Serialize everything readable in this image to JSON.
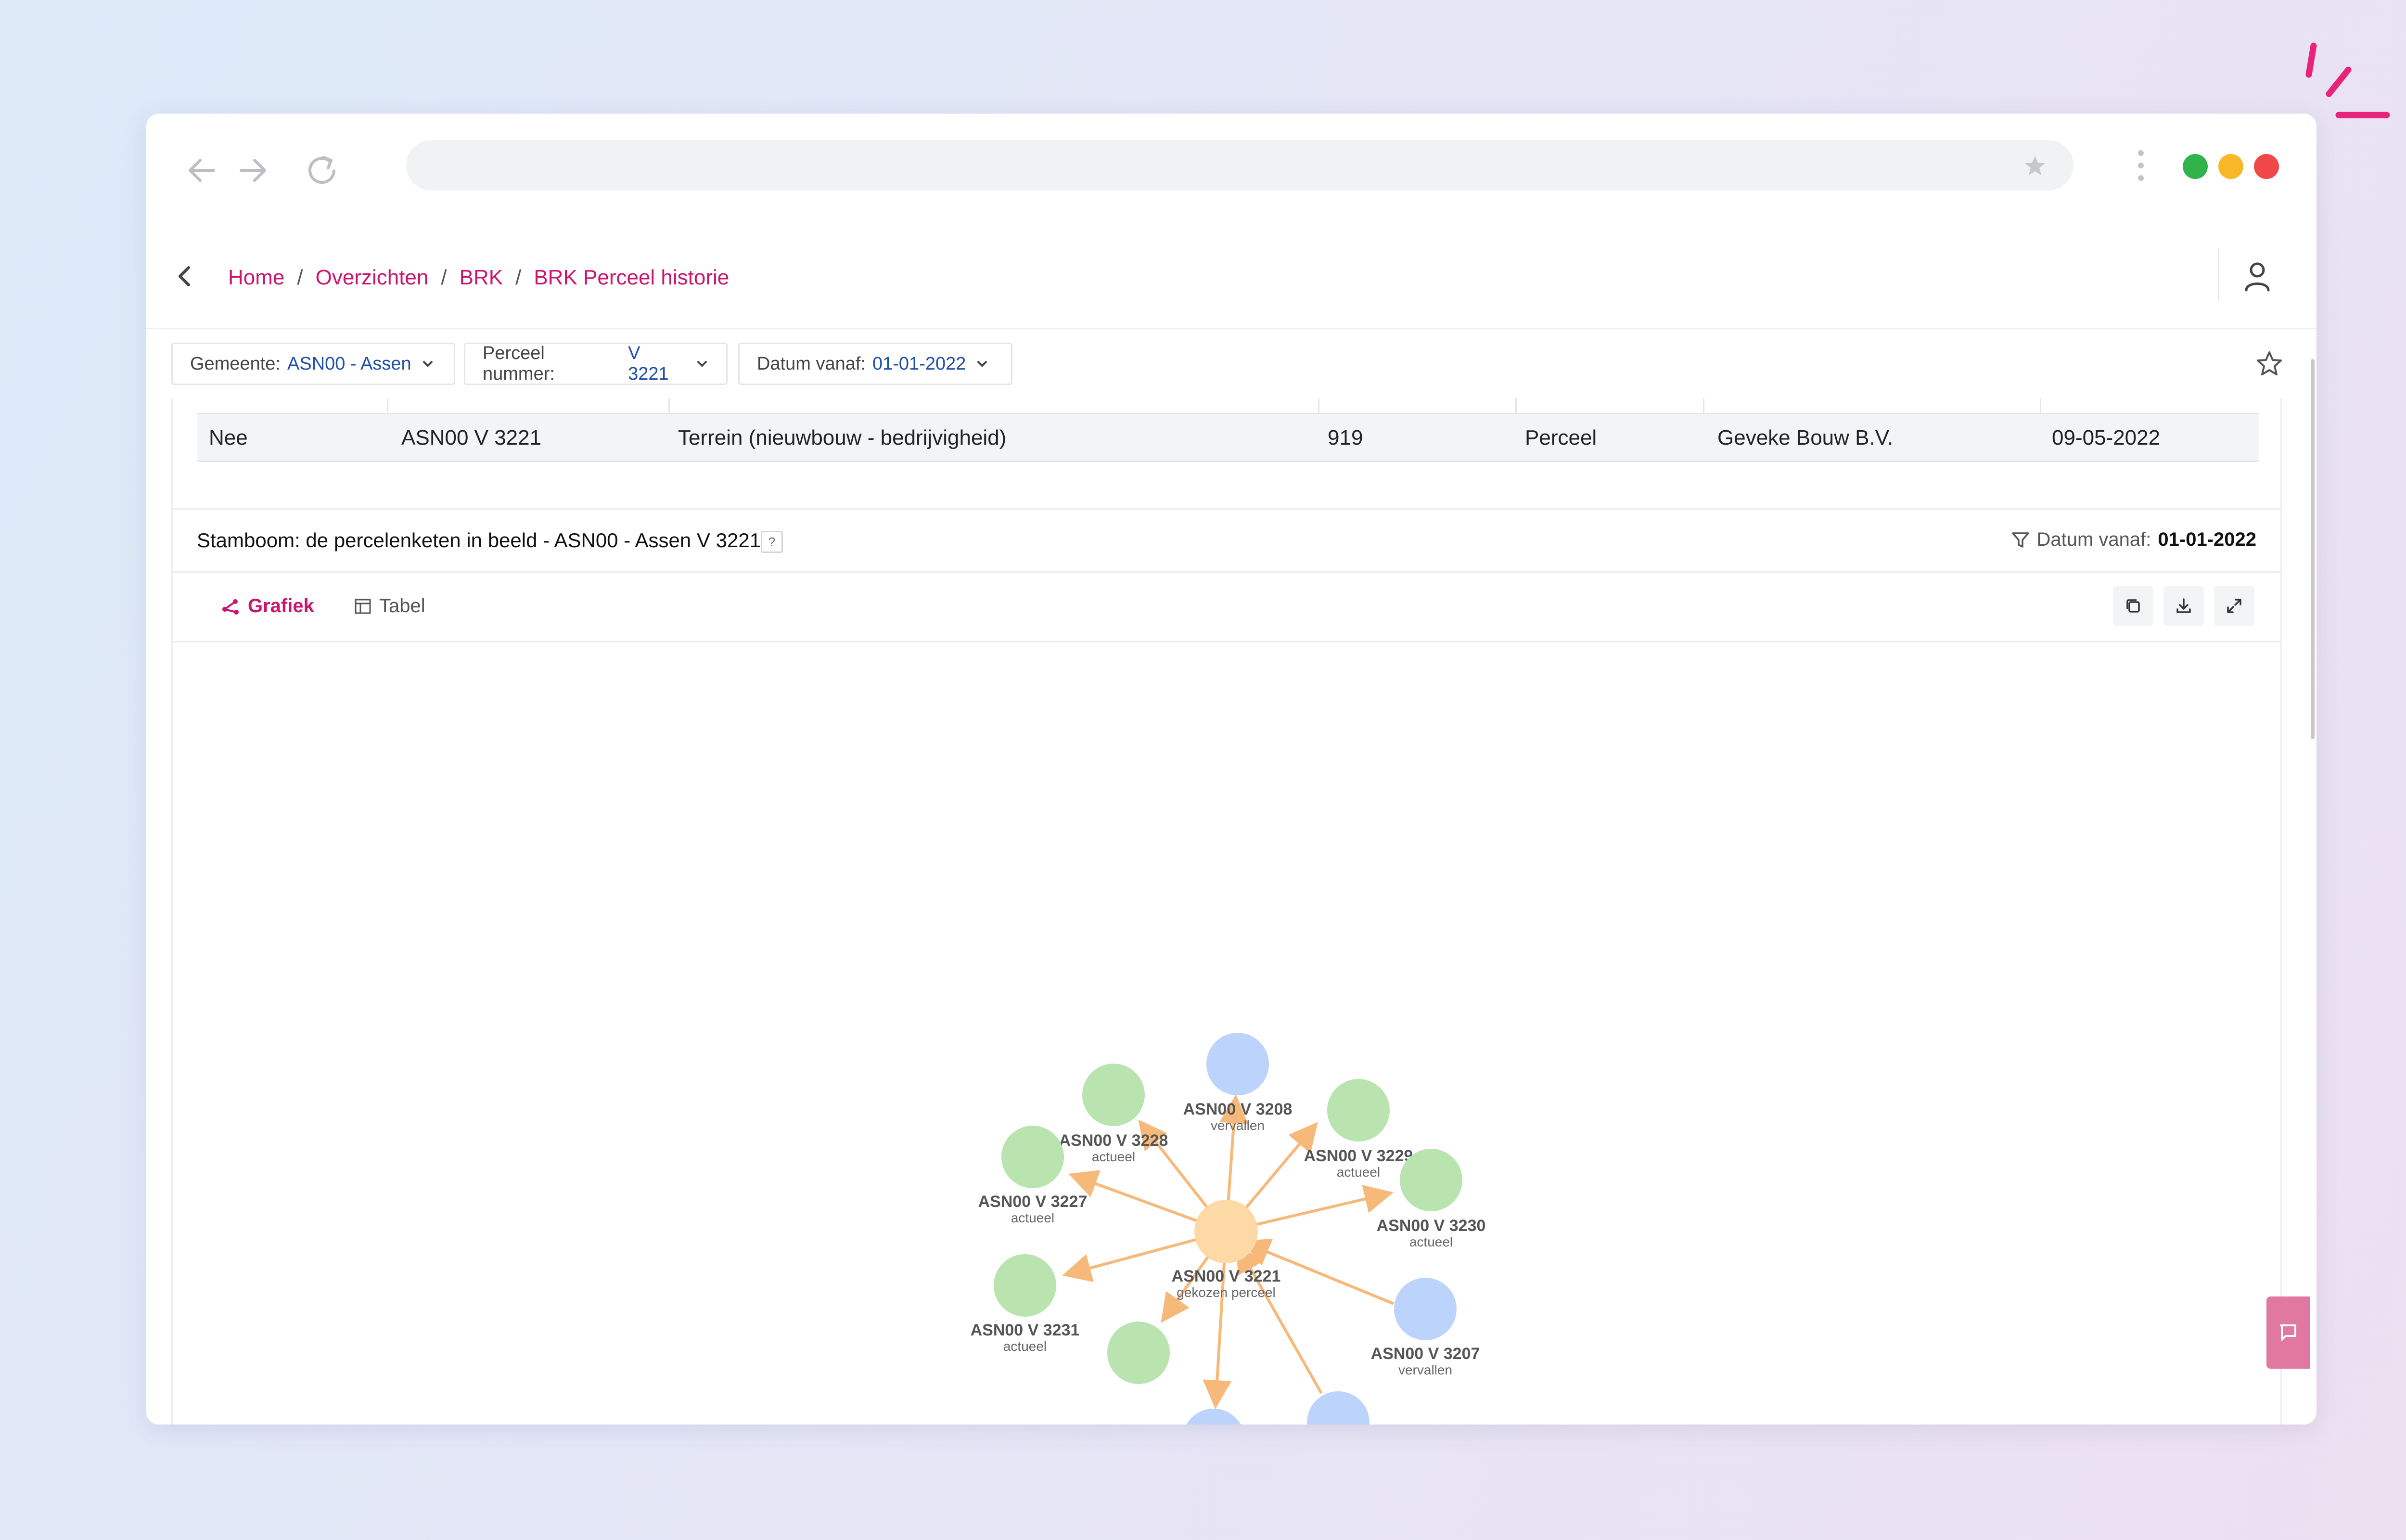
{
  "colors": {
    "accent": "#c8166e",
    "link_blue": "#1f4ea8",
    "node_current": "#b9e4b0",
    "node_expired": "#bcd3fb",
    "node_selected": "#fdd9a6",
    "edge": "#f7b97a",
    "dot_green": "#2fb34a",
    "dot_yellow": "#f7b928",
    "dot_red": "#f0474a"
  },
  "icons": {
    "back": "arrow-left-icon",
    "forward": "arrow-right-icon",
    "reload": "reload-icon",
    "bookmark": "star-icon",
    "user": "user-icon",
    "filter": "funnel-icon",
    "copy": "copy-icon",
    "download": "download-icon",
    "expand": "expand-icon",
    "chat": "chat-icon"
  },
  "breadcrumb": [
    {
      "label": "Home"
    },
    {
      "label": "Overzichten"
    },
    {
      "label": "BRK"
    },
    {
      "label": "BRK Perceel historie"
    }
  ],
  "filters": [
    {
      "label": "Gemeente:",
      "value": "ASN00 - Assen"
    },
    {
      "label": "Perceel nummer:",
      "value": "V 3221"
    },
    {
      "label": "Datum vanaf:",
      "value": "01-01-2022"
    }
  ],
  "table_row": [
    "Nee",
    "ASN00 V 3221",
    "Terrein (nieuwbouw - bedrijvigheid)",
    "919",
    "Perceel",
    "Geveke Bouw B.V.",
    "09-05-2022"
  ],
  "stamboom": {
    "title": "Stamboom: de percelenketen in beeld - ASN00 - Assen V 3221",
    "help": "?",
    "filter_label": "Datum vanaf:",
    "filter_value": "01-01-2022",
    "tabs": {
      "graph": "Grafiek",
      "table": "Tabel"
    }
  },
  "nodes": {
    "center": {
      "name": "ASN00 V 3221",
      "status": "gekozen perceel"
    },
    "n3208": {
      "name": "ASN00 V 3208",
      "status": "vervallen"
    },
    "n3229": {
      "name": "ASN00 V 3229",
      "status": "actueel"
    },
    "n3228": {
      "name": "ASN00 V 3228",
      "status": "actueel"
    },
    "n3227": {
      "name": "ASN00 V 3227",
      "status": "actueel"
    },
    "n3230": {
      "name": "ASN00 V 3230",
      "status": "actueel"
    },
    "n3231": {
      "name": "ASN00 V 3231",
      "status": "actueel"
    },
    "n3207": {
      "name": "ASN00 V 3207",
      "status": "vervallen"
    }
  }
}
